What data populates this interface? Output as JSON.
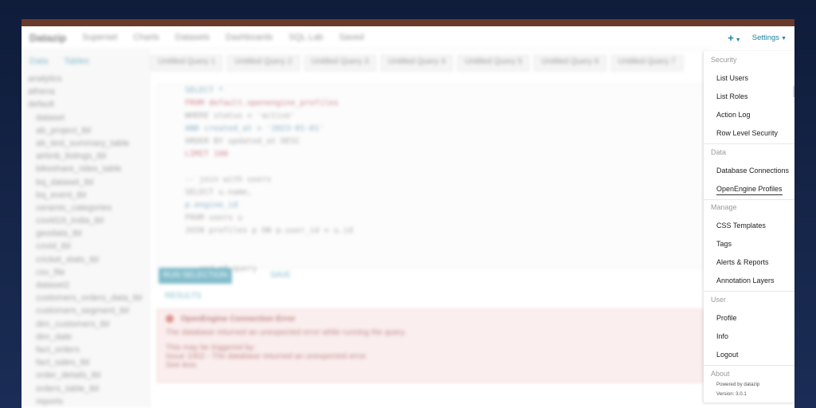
{
  "header": {
    "brand": "Datazip",
    "nav_links": [
      "Superset",
      "Charts",
      "Datasets",
      "Dashboards",
      "SQL Lab",
      "Saved"
    ],
    "plus_label": "+",
    "settings_label": "Settings"
  },
  "sidebar": {
    "tabs": [
      "Data",
      "Tables"
    ],
    "items": [
      "analytics",
      "athena",
      "default",
      "dataset",
      "ab_project_tbl",
      "ab_test_summary_table",
      "airbnb_listings_tbl",
      "bikeshare_rides_table",
      "bq_dataset_tbl",
      "bq_event_tbl",
      "ceramic_categories",
      "covid19_india_tbl",
      "geodata_tbl",
      "covid_tbl",
      "cricket_stats_tbl",
      "csv_file",
      "dataset2",
      "customers_orders_data_tbl",
      "customers_segment_tbl",
      "dim_customers_tbl",
      "dim_date",
      "fact_orders",
      "fact_sales_tbl",
      "order_details_tbl",
      "orders_table_tbl",
      "reports"
    ]
  },
  "query_tabs": [
    "Untitled Query 1",
    "Untitled Query 2",
    "Untitled Query 3",
    "Untitled Query 4",
    "Untitled Query 5",
    "Untitled Query 6",
    "Untitled Query 7"
  ],
  "editor": {
    "lines": [
      "SELECT *",
      "FROM default.openengine_profiles",
      "WHERE status = 'active'",
      "  AND created_at > '2023-01-01'",
      "ORDER BY updated_at DESC",
      "LIMIT 100",
      "",
      "-- join with users",
      "SELECT u.name,",
      "  p.engine_id",
      "FROM users u",
      "JOIN profiles p ON p.user_id = u.id",
      "",
      "",
      "-- end of query",
      ""
    ],
    "run_label": "RUN SELECTION",
    "save_label": "SAVE"
  },
  "results": {
    "tab_label": "RESULTS",
    "error_title": "OpenEngine Connection Error",
    "error_line1": "The database returned an unexpected error while running the query.",
    "error_line2": "This may be triggered by:",
    "error_line3": "Issue 1002 - The database returned an unexpected error.",
    "error_line4": "See less"
  },
  "dropdown": {
    "sections": [
      {
        "label": "Security",
        "items": [
          "List Users",
          "List Roles",
          "Action Log",
          "Row Level Security"
        ]
      },
      {
        "label": "Data",
        "items": [
          "Database Connections",
          "OpenEngine Profiles"
        ]
      },
      {
        "label": "Manage",
        "items": [
          "CSS Templates",
          "Tags",
          "Alerts & Reports",
          "Annotation Layers"
        ]
      },
      {
        "label": "User",
        "items": [
          "Profile",
          "Info",
          "Logout"
        ]
      },
      {
        "label": "About",
        "items": []
      }
    ],
    "powered_by": "Powered by datazip",
    "version": "Version: 3.0.1"
  },
  "colors": {
    "accent": "#1a85a0",
    "background": "#16264a",
    "error_bg": "#f8e1e1"
  }
}
